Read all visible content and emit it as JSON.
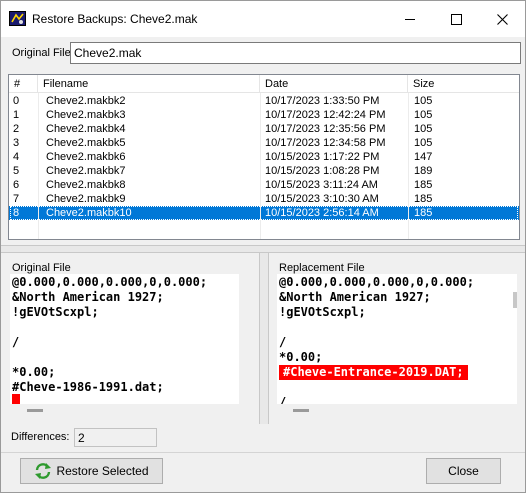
{
  "window": {
    "title": "Restore Backups: Cheve2.mak"
  },
  "original_file": {
    "label": "Original File",
    "value": "Cheve2.mak"
  },
  "backups": {
    "columns": [
      "#",
      "Filename",
      "Date",
      "Size"
    ],
    "rows": [
      {
        "num": "0",
        "filename": "Cheve2.makbk2",
        "date": "10/17/2023 1:33:50 PM",
        "size": "105"
      },
      {
        "num": "1",
        "filename": "Cheve2.makbk3",
        "date": "10/17/2023 12:42:24 PM",
        "size": "105"
      },
      {
        "num": "2",
        "filename": "Cheve2.makbk4",
        "date": "10/17/2023 12:35:56 PM",
        "size": "105"
      },
      {
        "num": "3",
        "filename": "Cheve2.makbk5",
        "date": "10/17/2023 12:34:58 PM",
        "size": "105"
      },
      {
        "num": "4",
        "filename": "Cheve2.makbk6",
        "date": "10/15/2023 1:17:22 PM",
        "size": "147"
      },
      {
        "num": "5",
        "filename": "Cheve2.makbk7",
        "date": "10/15/2023 1:08:28 PM",
        "size": "189"
      },
      {
        "num": "6",
        "filename": "Cheve2.makbk8",
        "date": "10/15/2023 3:11:24 AM",
        "size": "185"
      },
      {
        "num": "7",
        "filename": "Cheve2.makbk9",
        "date": "10/15/2023 3:10:30 AM",
        "size": "185"
      },
      {
        "num": "8",
        "filename": "Cheve2.makbk10",
        "date": "10/15/2023 2:56:14 AM",
        "size": "185"
      }
    ],
    "selected_index": 8
  },
  "original_pane": {
    "label": "Original File",
    "lines": [
      "@0.000,0.000,0.000,0,0.000;",
      "&North American 1927;",
      "!gEVOtScxpl;",
      "",
      "/",
      "",
      "*0.00;",
      "#Cheve-1986-1991.dat;"
    ]
  },
  "replacement_pane": {
    "label": "Replacement File",
    "lines": [
      "@0.000,0.000,0.000,0,0.000;",
      "&North American 1927;",
      "!gEVOtScxpl;",
      "",
      "/",
      "*0.00;",
      "#Cheve-Entrance-2019.DAT;",
      "",
      "/"
    ],
    "highlighted_line": 6
  },
  "differences": {
    "label": "Differences:",
    "value": "2"
  },
  "buttons": {
    "restore": "Restore Selected",
    "close": "Close"
  },
  "colors": {
    "selection": "#0078d7",
    "diff_highlight": "#ff0000",
    "restore_icon": "#2e9a2e"
  },
  "icons": {
    "app": "app-icon",
    "minimize": "minimize-icon",
    "maximize": "maximize-icon",
    "close": "close-icon",
    "restore": "refresh-icon"
  }
}
